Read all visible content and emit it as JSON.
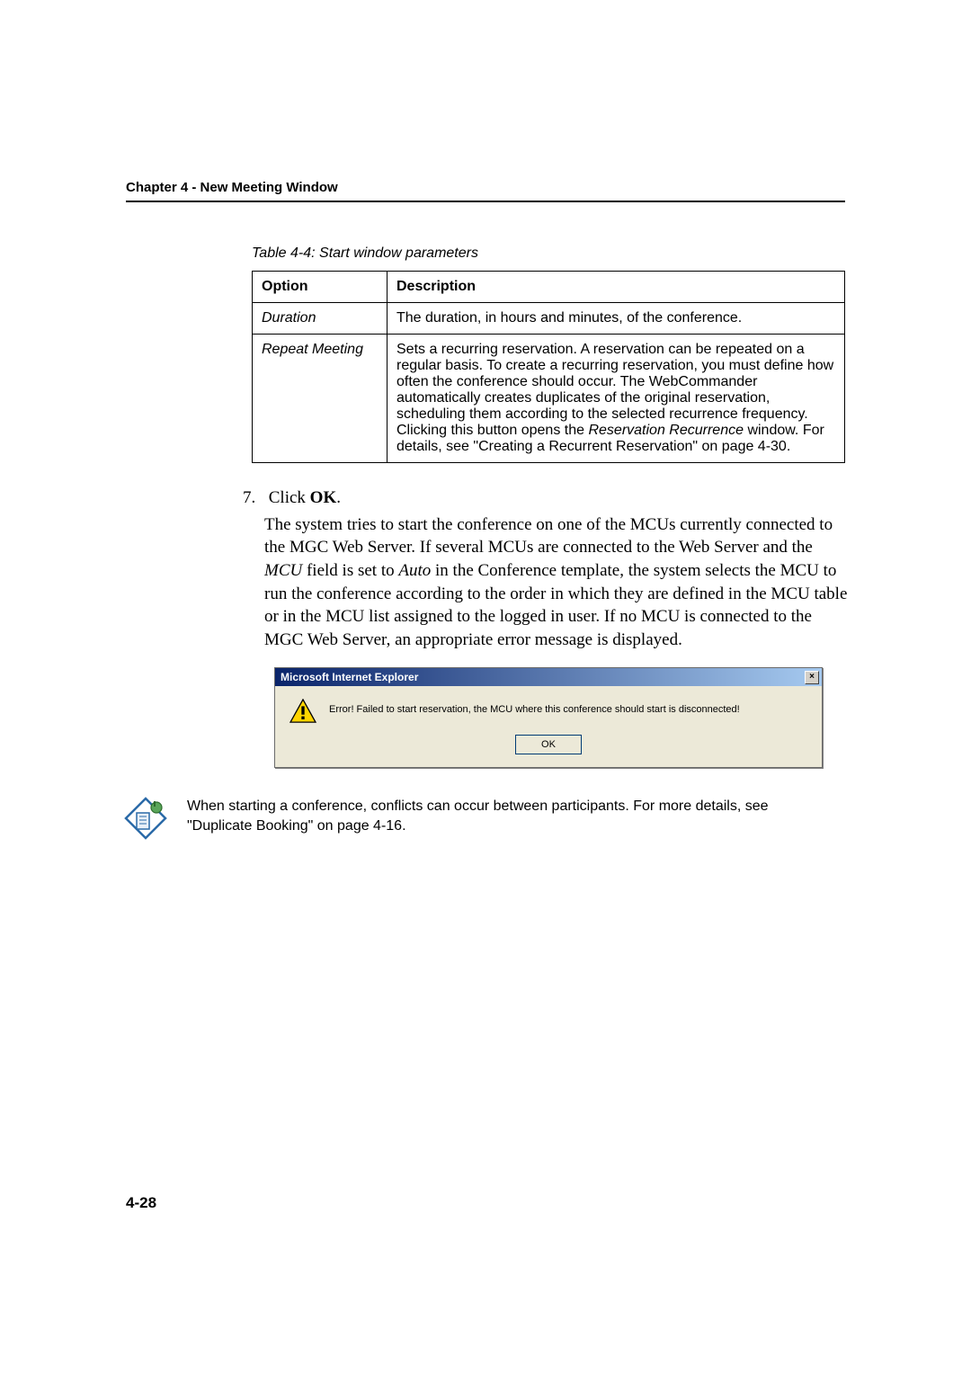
{
  "chapter_header": "Chapter 4 - New Meeting Window",
  "table_caption": "Table 4-4: Start window parameters",
  "table": {
    "headers": [
      "Option",
      "Description"
    ],
    "rows": [
      {
        "option": "Duration",
        "description": "The duration, in hours and minutes, of the conference."
      },
      {
        "option": "Repeat Meeting",
        "description_pre": "Sets a recurring reservation. A reservation can be repeated on a regular basis. To create a recurring reservation, you must define how often the conference should occur. The WebCommander automatically creates duplicates of the original reservation, scheduling them according to the selected recurrence frequency. Clicking this button opens the ",
        "description_em": "Reservation Recurrence",
        "description_post": " window. For details, see \"Creating a Recurrent Reservation\" on page 4-30."
      }
    ]
  },
  "step": {
    "number": "7.",
    "instruction_pre": "Click ",
    "instruction_bold": "OK",
    "instruction_post": ".",
    "body_parts": {
      "p1": "The system tries to start the conference on one of the MCUs currently connected to the MGC Web Server. If several MCUs are connected to the Web Server and the ",
      "em1": "MCU",
      "p2": " field is set to ",
      "em2": "Auto",
      "p3": " in the Conference template, the system selects the MCU to run the conference according to the order in which they are defined in the MCU table or in the MCU list assigned to the logged in user. If no MCU is connected to the MGC Web Server, an appropriate error message is displayed."
    }
  },
  "dialog": {
    "title": "Microsoft Internet Explorer",
    "close_label": "×",
    "message": "Error! Failed to start reservation, the MCU where this conference should start is disconnected!",
    "ok_label": "OK"
  },
  "note": "When starting a conference, conflicts can occur between participants. For more details, see \"Duplicate Booking\" on page 4-16.",
  "page_number": "4-28"
}
